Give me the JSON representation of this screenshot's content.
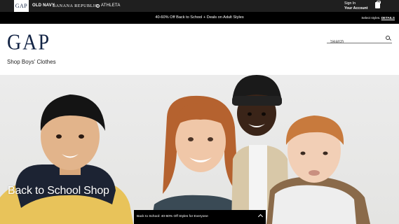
{
  "brand_bar": {
    "gap_tab": "GAP",
    "old_navy": "OLD NAVY",
    "banana_republic": "BANANA REPUBLIC",
    "athleta": "ATHLETA",
    "sign_in": "Sign In",
    "your_account": "Your Account",
    "bag_icon": "shopping-bag-icon"
  },
  "promo_bar": {
    "text": "40-60% Off Back to School + Deals on Adult Styles",
    "exclusions": "Select styles.",
    "details_link": "DETAILS"
  },
  "header": {
    "logo": "GAP",
    "search_placeholder": "Search",
    "search_icon": "magnifier-icon"
  },
  "page_title": "Shop Boys' Clothes",
  "hero": {
    "title": "Back to School Shop"
  },
  "sticky_banner": {
    "text": "Back to School: 40-60% Off Styles for Everyone",
    "icon": "chevron-up-icon"
  },
  "colors": {
    "gap_navy": "#122344",
    "brand_bar_bg": "#1f1f1f",
    "promo_bar_bg": "#000000"
  }
}
